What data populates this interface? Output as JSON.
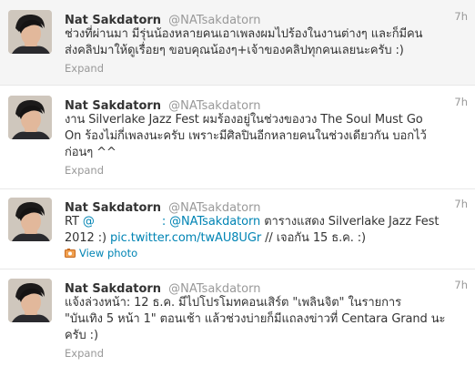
{
  "tweets": [
    {
      "name": "Nat Sakdatorn",
      "handle": "@NATsakdatorn",
      "time": "7h",
      "text": "ช่วงที่ผ่านมา มีรุ่นน้องหลายคนเอาเพลงผมไปร้องในงานต่างๆ และก็มีคน\nส่งคลิปมาให้ดูเรื่อยๆ ขอบคุณน้องๆ+เจ้าของคลิปทุกคนเลยนะครับ :)",
      "action": "Expand"
    },
    {
      "name": "Nat Sakdatorn",
      "handle": "@NATsakdatorn",
      "time": "7h",
      "text": "งาน Silverlake Jazz Fest ผมร้องอยู่ในช่วงของวง The Soul Must Go\nOn ร้องไม่กี่เพลงนะครับ เพราะมีศิลปินอีกหลายคนในช่วงเดียวกัน บอกไว้\nก่อนๆ ^^",
      "action": "Expand"
    },
    {
      "name": "Nat Sakdatorn",
      "handle": "@NATsakdatorn",
      "time": "7h",
      "text_parts": {
        "rt": "RT",
        "mention1": "@",
        "colon": ":",
        "mention2": "@NATsakdatorn",
        "body1": "ตารางแสดง Silverlake Jazz Fest",
        "body2": "2012 :)",
        "link": "pic.twitter.com/twAU8UGr",
        "body3": "// เจอกัน 15 ธ.ค. :)"
      },
      "action": "View photo"
    },
    {
      "name": "Nat Sakdatorn",
      "handle": "@NATsakdatorn",
      "time": "7h",
      "text": "แจ้งล่วงหน้า: 12 ธ.ค. มีไปโปรโมทคอนเสิร์ต \"เพลินจิต\" ในรายการ\n\"บันเทิง 5 หน้า 1\" ตอนเช้า แล้วช่วงบ่ายก็มีแถลงข่าวที่ Centara Grand นะ\nครับ :)",
      "action": "Expand"
    }
  ],
  "colors": {
    "link": "#0084b4",
    "muted": "#999999",
    "text": "#333333"
  }
}
